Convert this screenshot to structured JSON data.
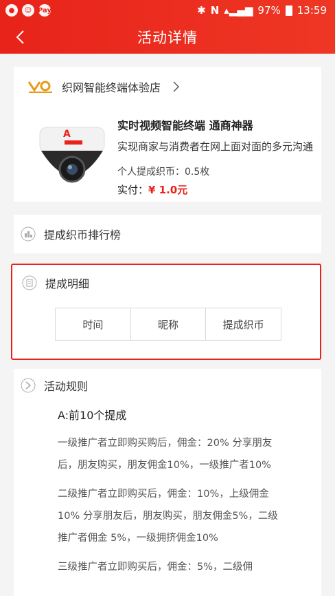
{
  "status": {
    "battery": "97%",
    "time": "13:59",
    "left_icons": [
      "wechat-icon",
      "contact-icon",
      "pay-icon"
    ],
    "pay_label": "Pay"
  },
  "nav": {
    "title": "活动详情"
  },
  "store": {
    "name": "织网智能终端体验店"
  },
  "product": {
    "title": "实时视频智能终端 通商神器",
    "desc": "实现商家与消费者在网上面对面的多元沟通",
    "coin_label": "个人提成织币：0.5枚",
    "pay_label": "实付：",
    "price": "¥ 1.0元"
  },
  "ranking": {
    "title": "提成织币排行榜"
  },
  "detail": {
    "title": "提成明细",
    "columns": [
      "时间",
      "昵称",
      "提成织币"
    ]
  },
  "rules": {
    "title": "活动规则",
    "subtitle": "A:前10个提成",
    "paragraphs": [
      "一级推广者立即购买购后，佣金：20% 分享朋友后，朋友购买，朋友佣金10%，一级推广者10%",
      "二级推广者立即购买后，佣金：10%，上级佣金10% 分享朋友后，朋友购买，朋友佣金5%，二级推广者佣金 5%，一级拥挤佣金10%",
      "三级推广者立即购买后，佣金：5%，二级佣"
    ]
  },
  "colors": {
    "brand_red": "#e8231a"
  }
}
